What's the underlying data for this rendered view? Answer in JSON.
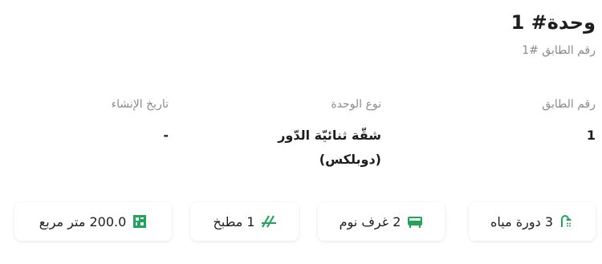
{
  "unit": {
    "title": "وحدة# 1",
    "floor_subtitle": "رقم الطابق #1"
  },
  "details": [
    {
      "label": "رقم الطابق",
      "value": "1"
    },
    {
      "label": "نوع الوحدة",
      "value": "شقّة ثنائيّة الدّور (دوبلكس)"
    },
    {
      "label": "تاريخ الإنشاء",
      "value": "-"
    }
  ],
  "features": [
    {
      "text": "3 دورة مياه",
      "icon": "shower-icon"
    },
    {
      "text": "2 غرف نوم",
      "icon": "bed-icon"
    },
    {
      "text": "1 مطبخ",
      "icon": "kitchen-icon"
    },
    {
      "text": "200.0 متر مربع",
      "icon": "area-icon"
    }
  ],
  "colors": {
    "accent": "#22a55b",
    "label": "#8c8c8c",
    "text": "#1e1e1e"
  }
}
